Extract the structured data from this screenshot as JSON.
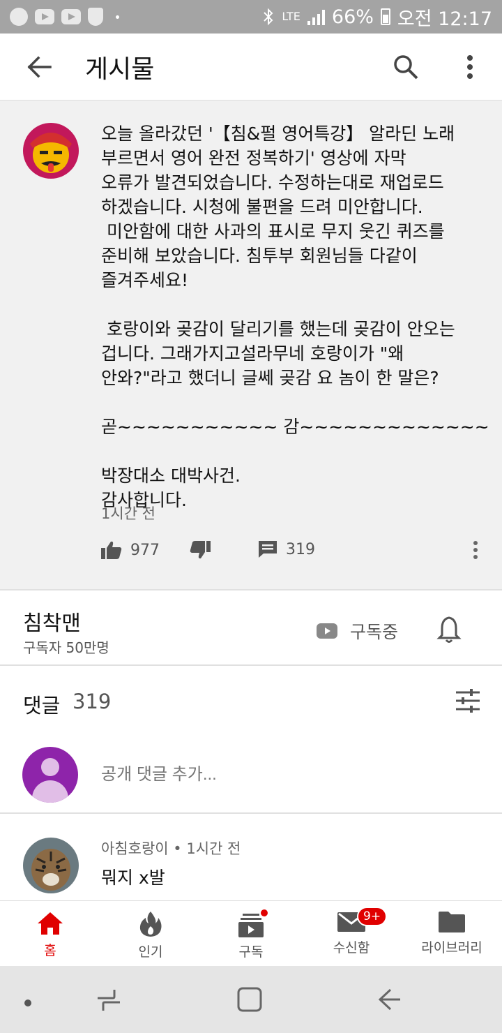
{
  "status_bar": {
    "network": "LTE",
    "battery": "66%",
    "time": "오전 12:17"
  },
  "app_bar": {
    "title": "게시물"
  },
  "post": {
    "body": "오늘 올라갔던 '【침&펄 영어특강】 알라딘 노래\n부르면서 영어 완전 정복하기' 영상에 자막\n오류가 발견되었습니다. 수정하는대로 재업로드\n하겠습니다. 시청에 불편을 드려 미안합니다.\n 미안함에 대한 사과의 표시로 무지 웃긴 퀴즈를\n준비해 보았습니다. 침투부 회원님들 다같이\n즐겨주세요!\n\n 호랑이와 곶감이 달리기를 했는데 곶감이 안오는\n겁니다. 그래가지고설라무네 호랑이가 \"왜\n안와?\"라고 했더니 글쎄 곶감 요 놈이 한 말은?\n\n곧~~~~~~~~~~~ 감~~~~~~~~~~~~~\n\n박장대소 대박사건.\n감사합니다.",
    "time": "1시간 전",
    "likes": "977",
    "comments": "319"
  },
  "channel": {
    "name": "침착맨",
    "subscribers": "구독자 50만명",
    "subscribe_label": "구독중"
  },
  "comments_section": {
    "title": "댓글",
    "count": "319",
    "add_placeholder": "공개 댓글 추가...",
    "items": [
      {
        "author": "아침호랑이",
        "time": "1시간 전",
        "meta": "아침호랑이 • 1시간 전",
        "text": "뭐지 x발"
      }
    ]
  },
  "bottom_nav": {
    "items": [
      {
        "label": "홈",
        "icon": "home-icon"
      },
      {
        "label": "인기",
        "icon": "flame-icon"
      },
      {
        "label": "구독",
        "icon": "subscriptions-icon"
      },
      {
        "label": "수신함",
        "icon": "inbox-icon",
        "badge": "9+"
      },
      {
        "label": "라이브러리",
        "icon": "folder-icon"
      }
    ]
  },
  "colors": {
    "accent": "#e00000",
    "post_background": "#f1f1f1",
    "status_bar": "#a4a4a4"
  }
}
